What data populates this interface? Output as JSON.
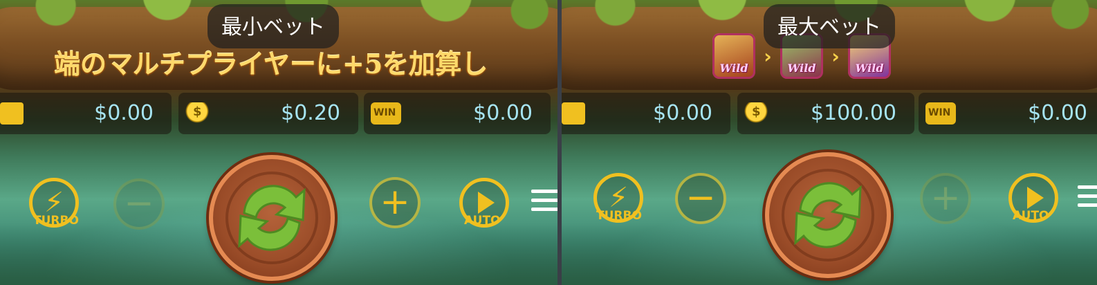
{
  "left_panel": {
    "tooltip": "最小ベット",
    "banner": "端のマルチプライヤーに+5を加算し",
    "balance": "$0.00",
    "bet": "$0.20",
    "win": "$0.00",
    "turbo_label": "TURBO",
    "auto_label": "AUTO",
    "minus_enabled": false,
    "plus_enabled": true
  },
  "right_panel": {
    "tooltip": "最大ベット",
    "wild_symbols": [
      "Wild",
      "Wild",
      "Wild"
    ],
    "balance": "$0.00",
    "bet": "$100.00",
    "win": "$0.00",
    "turbo_label": "TURBO",
    "auto_label": "AUTO",
    "minus_enabled": true,
    "plus_enabled": false
  },
  "icons": {
    "balance": "wallet-icon",
    "bet": "coin-stack-icon",
    "win": "win-icon",
    "turbo": "lightning-icon",
    "auto": "play-icon",
    "menu": "hamburger-menu-icon",
    "spin": "spin-arrows-icon"
  },
  "colors": {
    "value_text": "#a6e4f2",
    "accent": "#f0c020",
    "spin_button": "#9a4c28"
  }
}
